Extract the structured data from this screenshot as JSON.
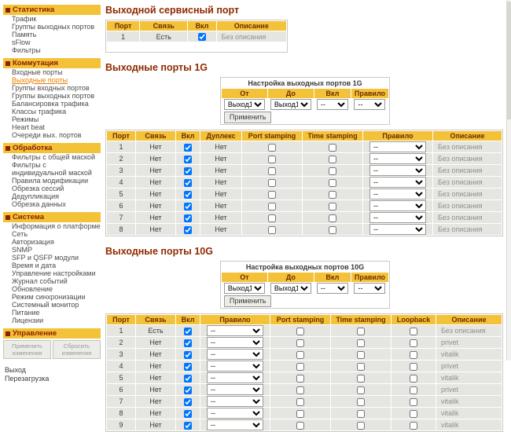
{
  "theme": {
    "accent_yellow": "#F4C239",
    "title_color": "#8E2A00",
    "active_link_color": "#E58000"
  },
  "sidebar": {
    "sections": [
      {
        "title": "Статистика",
        "items": [
          "Трафик",
          "Группы выходных портов",
          "Память",
          "sFlow",
          "Фильтры"
        ]
      },
      {
        "title": "Коммутация",
        "items": [
          "Входные порты",
          "Выходные порты",
          "Группы входных портов",
          "Группы выходных портов",
          "Балансировка трафика",
          "Классы трафика",
          "Режимы",
          "Heart beat",
          "Очереди вых. портов"
        ]
      },
      {
        "title": "Обработка",
        "items": [
          "Фильтры с общей маской",
          "Фильтры с индивидуальной маской",
          "Правила модификации",
          "Обрезка сессий",
          "Дедупликация",
          "Обрезка данных"
        ]
      },
      {
        "title": "Система",
        "items": [
          "Информация о платформе",
          "Сеть",
          "Авторизация",
          "SNMP",
          "SFP и QSFP модули",
          "Время и дата",
          "Управление настройками",
          "Журнал событий",
          "Обновление",
          "Режим синхронизации",
          "Системный монитор",
          "Питание",
          "Лицензии"
        ]
      }
    ],
    "active_item": "Выходные порты",
    "management": {
      "title": "Управление",
      "apply_label": "Применить изменения",
      "reset_label": "Сбросить изменения"
    },
    "links": [
      "Выход",
      "Перезагрузка"
    ]
  },
  "service_port": {
    "title": "Выходной сервисный порт",
    "columns": [
      "Порт",
      "Связь",
      "Вкл",
      "Описание"
    ],
    "rows": [
      {
        "port": "1",
        "link": "Есть",
        "enabled": true,
        "description": "Без описания"
      }
    ]
  },
  "ports_1g": {
    "title": "Выходные порты 1G",
    "settings": {
      "title": "Настройка выходных портов 1G",
      "headers": [
        "От",
        "До",
        "Вкл",
        "Правило"
      ],
      "from": "Выход1",
      "to": "Выход1",
      "enable": "--",
      "rule": "--",
      "apply_label": "Применить"
    },
    "columns": [
      "Порт",
      "Связь",
      "Вкл",
      "Дуплекс",
      "Port stamping",
      "Time stamping",
      "Правило",
      "Описание"
    ],
    "rows": [
      {
        "port": "1",
        "link": "Нет",
        "enabled": true,
        "duplex": "Нет",
        "port_stamping": false,
        "time_stamping": false,
        "rule": "--",
        "description": "Без описания"
      },
      {
        "port": "2",
        "link": "Нет",
        "enabled": true,
        "duplex": "Нет",
        "port_stamping": false,
        "time_stamping": false,
        "rule": "--",
        "description": "Без описания"
      },
      {
        "port": "3",
        "link": "Нет",
        "enabled": true,
        "duplex": "Нет",
        "port_stamping": false,
        "time_stamping": false,
        "rule": "--",
        "description": "Без описания"
      },
      {
        "port": "4",
        "link": "Нет",
        "enabled": true,
        "duplex": "Нет",
        "port_stamping": false,
        "time_stamping": false,
        "rule": "--",
        "description": "Без описания"
      },
      {
        "port": "5",
        "link": "Нет",
        "enabled": true,
        "duplex": "Нет",
        "port_stamping": false,
        "time_stamping": false,
        "rule": "--",
        "description": "Без описания"
      },
      {
        "port": "6",
        "link": "Нет",
        "enabled": true,
        "duplex": "Нет",
        "port_stamping": false,
        "time_stamping": false,
        "rule": "--",
        "description": "Без описания"
      },
      {
        "port": "7",
        "link": "Нет",
        "enabled": true,
        "duplex": "Нет",
        "port_stamping": false,
        "time_stamping": false,
        "rule": "--",
        "description": "Без описания"
      },
      {
        "port": "8",
        "link": "Нет",
        "enabled": true,
        "duplex": "Нет",
        "port_stamping": false,
        "time_stamping": false,
        "rule": "--",
        "description": "Без описания"
      }
    ]
  },
  "ports_10g": {
    "title": "Выходные порты 10G",
    "settings": {
      "title": "Настройка выходных портов 10G",
      "headers": [
        "От",
        "До",
        "Вкл",
        "Правило"
      ],
      "from": "Выход1",
      "to": "Выход1",
      "enable": "--",
      "rule": "--",
      "apply_label": "Применить"
    },
    "columns": [
      "Порт",
      "Связь",
      "Вкл",
      "Правило",
      "Port stamping",
      "Time stamping",
      "Loopback",
      "Описание"
    ],
    "rows": [
      {
        "port": "1",
        "link": "Есть",
        "enabled": true,
        "rule": "--",
        "port_stamping": false,
        "time_stamping": false,
        "loopback": false,
        "description": "Без описания"
      },
      {
        "port": "2",
        "link": "Нет",
        "enabled": true,
        "rule": "--",
        "port_stamping": false,
        "time_stamping": false,
        "loopback": false,
        "description": "privet"
      },
      {
        "port": "3",
        "link": "Нет",
        "enabled": true,
        "rule": "--",
        "port_stamping": false,
        "time_stamping": false,
        "loopback": false,
        "description": "vitalik"
      },
      {
        "port": "4",
        "link": "Нет",
        "enabled": true,
        "rule": "--",
        "port_stamping": false,
        "time_stamping": false,
        "loopback": false,
        "description": "privet"
      },
      {
        "port": "5",
        "link": "Нет",
        "enabled": true,
        "rule": "--",
        "port_stamping": false,
        "time_stamping": false,
        "loopback": false,
        "description": "vitalik"
      },
      {
        "port": "6",
        "link": "Нет",
        "enabled": true,
        "rule": "--",
        "port_stamping": false,
        "time_stamping": false,
        "loopback": false,
        "description": "privet"
      },
      {
        "port": "7",
        "link": "Нет",
        "enabled": true,
        "rule": "--",
        "port_stamping": false,
        "time_stamping": false,
        "loopback": false,
        "description": "vitalik"
      },
      {
        "port": "8",
        "link": "Нет",
        "enabled": true,
        "rule": "--",
        "port_stamping": false,
        "time_stamping": false,
        "loopback": false,
        "description": "vitalik"
      },
      {
        "port": "9",
        "link": "Нет",
        "enabled": true,
        "rule": "--",
        "port_stamping": false,
        "time_stamping": false,
        "loopback": false,
        "description": "vitalik"
      }
    ]
  }
}
